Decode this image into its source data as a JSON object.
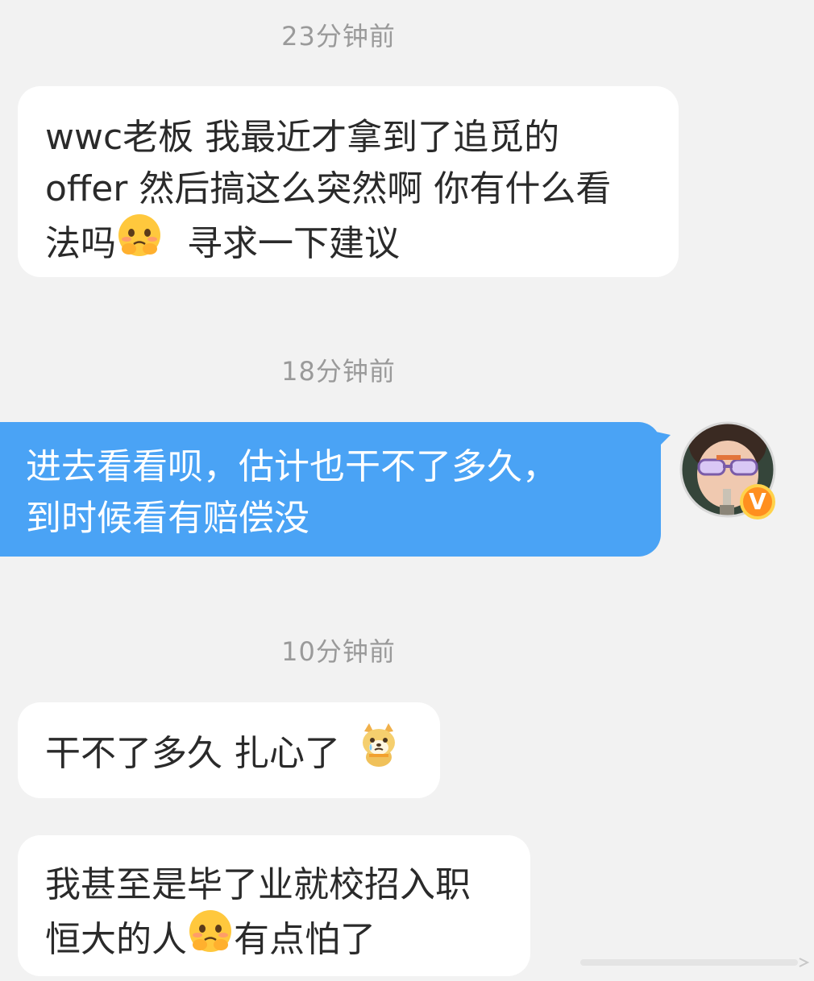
{
  "messages": [
    {
      "timestamp": "23分钟前",
      "lines": [
        "wwc老板 我最近才拿到了追觅的",
        "offer 然后搞这么突然啊 你有什么看",
        "法吗",
        "寻求一下建议"
      ]
    },
    {
      "timestamp": "18分钟前",
      "lines": [
        "进去看看呗，估计也干不了多久，",
        "到时候看有赔偿没"
      ]
    },
    {
      "timestamp": "10分钟前",
      "lines": [
        "干不了多久 扎心了"
      ]
    },
    {
      "lines": [
        "我甚至是毕了业就校招入职",
        "恒大的人",
        "有点怕了"
      ]
    }
  ],
  "icons": {
    "shy_emoji": "pleading-face-emoji-icon",
    "cry_dog_emoji": "crying-doge-emoji-icon",
    "verified_badge": "v-badge-icon"
  },
  "avatar": {
    "badge_text": "V"
  },
  "colors": {
    "background": "#f2f2f2",
    "incoming_bubble": "#ffffff",
    "outgoing_bubble": "#4aa3f5",
    "timestamp_text": "#9a9a9a",
    "badge": "#ff8f1f"
  }
}
